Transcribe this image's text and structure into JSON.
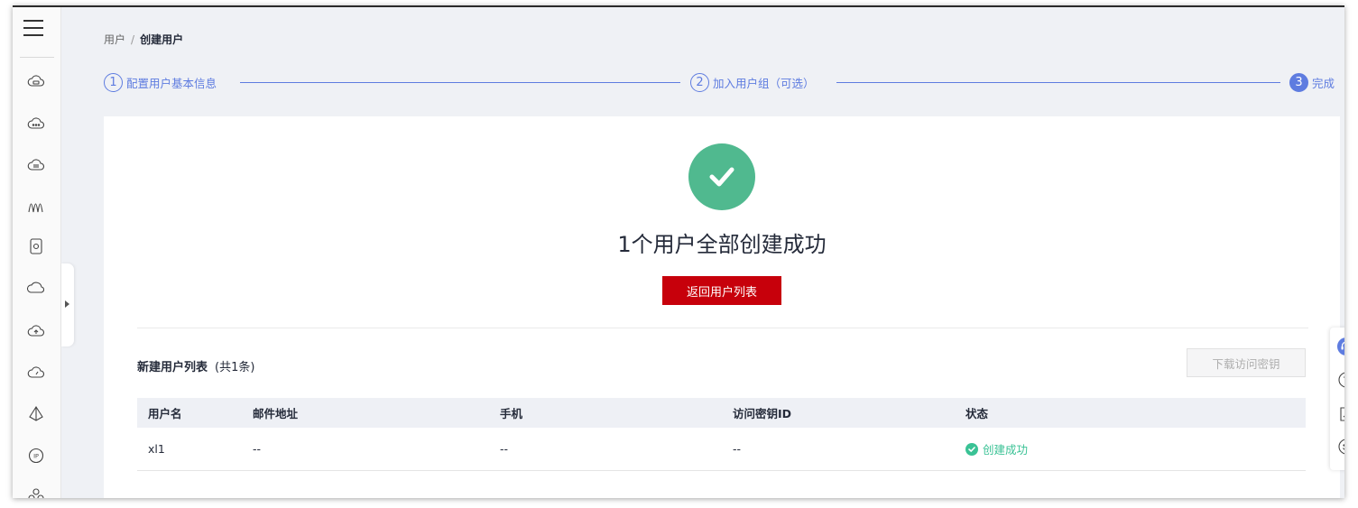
{
  "breadcrumb": {
    "parent": "用户",
    "separator": "/",
    "current": "创建用户"
  },
  "steps": [
    {
      "num": "1",
      "label": "配置用户基本信息"
    },
    {
      "num": "2",
      "label": "加入用户组（可选）"
    },
    {
      "num": "3",
      "label": "完成"
    }
  ],
  "result": {
    "title": "1个用户全部创建成功",
    "back_button": "返回用户列表"
  },
  "list": {
    "title": "新建用户列表",
    "count": "(共1条)",
    "download_button": "下载访问密钥",
    "columns": [
      "用户名",
      "邮件地址",
      "手机",
      "访问密钥ID",
      "状态"
    ],
    "rows": [
      {
        "username": "xl1",
        "email": "--",
        "phone": "--",
        "access_key_id": "--",
        "status": "创建成功"
      }
    ]
  },
  "colors": {
    "accent": "#5e7ce0",
    "success": "#50b98f",
    "danger_button": "#c7000b",
    "status_success": "#3ac295"
  },
  "sidebar_icons": [
    "cloud-server-icon",
    "cloud-dots-icon",
    "cloud-database-icon",
    "waves-icon",
    "storage-icon",
    "cloud-outline-icon",
    "cloud-upload-icon",
    "cloud-gauge-icon",
    "pyramid-icon",
    "ip-icon",
    "cluster-icon"
  ],
  "right_tools": [
    "headset-icon",
    "help-icon",
    "feedback-icon",
    "smile-icon"
  ]
}
